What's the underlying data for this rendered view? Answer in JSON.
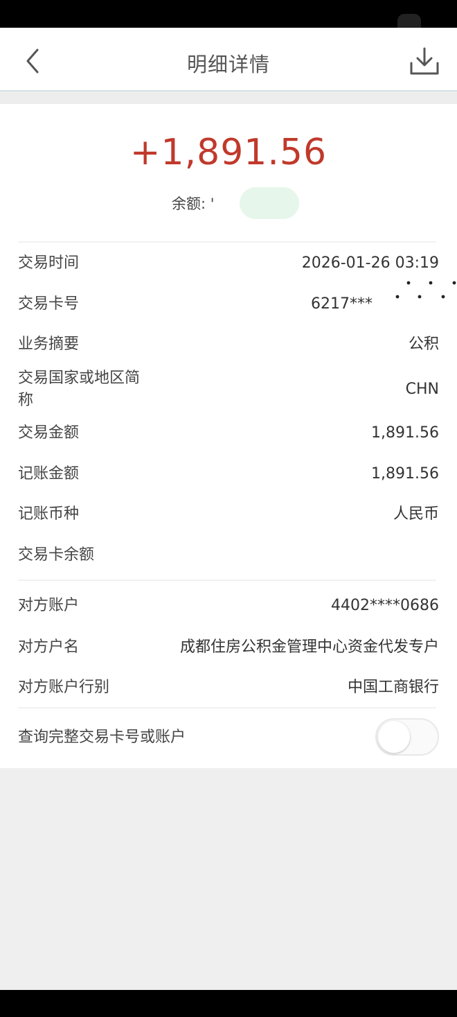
{
  "nav": {
    "title": "明细详情",
    "back_icon": "chevron-left-icon",
    "download_icon": "download-icon"
  },
  "summary": {
    "amount": "+1,891.56",
    "balance_label": "余额:",
    "balance_value": "'",
    "amount_color": "#c0392b"
  },
  "details": [
    {
      "label": "交易时间",
      "value": "2026-01-26 03:19"
    },
    {
      "label": "交易卡号",
      "value": "6217***"
    },
    {
      "label": "业务摘要",
      "value": "公积"
    },
    {
      "label": "交易国家或地区简称",
      "value": "CHN"
    },
    {
      "label": "交易金额",
      "value": "1,891.56"
    },
    {
      "label": "记账金额",
      "value": "1,891.56"
    },
    {
      "label": "记账币种",
      "value": "人民币"
    },
    {
      "label": "交易卡余额",
      "value": ""
    }
  ],
  "counterparty": [
    {
      "label": "对方账户",
      "value": "4402****0686"
    },
    {
      "label": "对方户名",
      "value": "成都住房公积金管理中心资金代发专户"
    },
    {
      "label": "对方账户行别",
      "value": "中国工商银行"
    }
  ],
  "toggle": {
    "label": "查询完整交易卡号或账户",
    "state": "off"
  }
}
